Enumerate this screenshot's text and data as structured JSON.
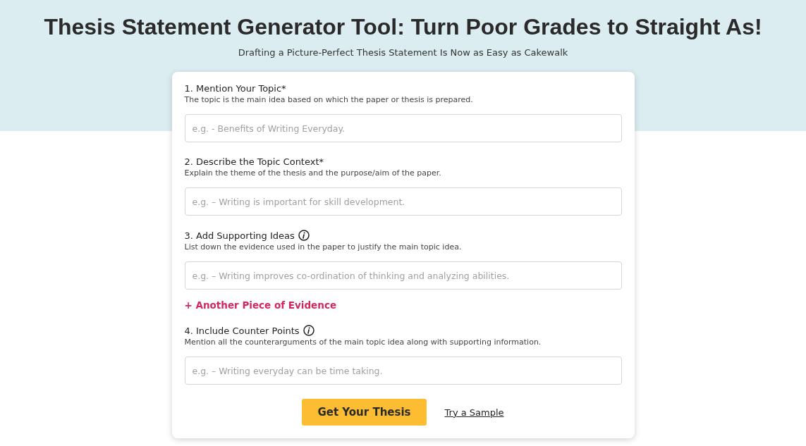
{
  "header": {
    "title": "Thesis Statement Generator Tool: Turn Poor Grades to Straight As!",
    "subtitle": "Drafting a Picture-Perfect Thesis Statement Is Now as Easy as Cakewalk"
  },
  "fields": [
    {
      "label": "1. Mention Your Topic*",
      "info": false,
      "hint": "The topic is the main idea based on which the paper or thesis is prepared.",
      "placeholder": "e.g. - Benefits of Writing Everyday."
    },
    {
      "label": "2. Describe the Topic Context*",
      "info": false,
      "hint": "Explain the theme of the thesis and the purpose/aim of the paper.",
      "placeholder": "e.g. – Writing is important for skill development."
    },
    {
      "label": "3. Add Supporting Ideas",
      "info": true,
      "hint": "List down the evidence used in the paper to justify the main topic idea.",
      "placeholder": "e.g. – Writing improves co-ordination of thinking and analyzing abilities.",
      "add_link": "+ Another Piece of Evidence"
    },
    {
      "label": "4. Include Counter Points",
      "info": true,
      "hint": "Mention all the counterarguments of the main topic idea along with supporting information.",
      "placeholder": "e.g. – Writing everyday can be time taking."
    }
  ],
  "submit": "Get Your Thesis",
  "sample_link": "Try a Sample"
}
